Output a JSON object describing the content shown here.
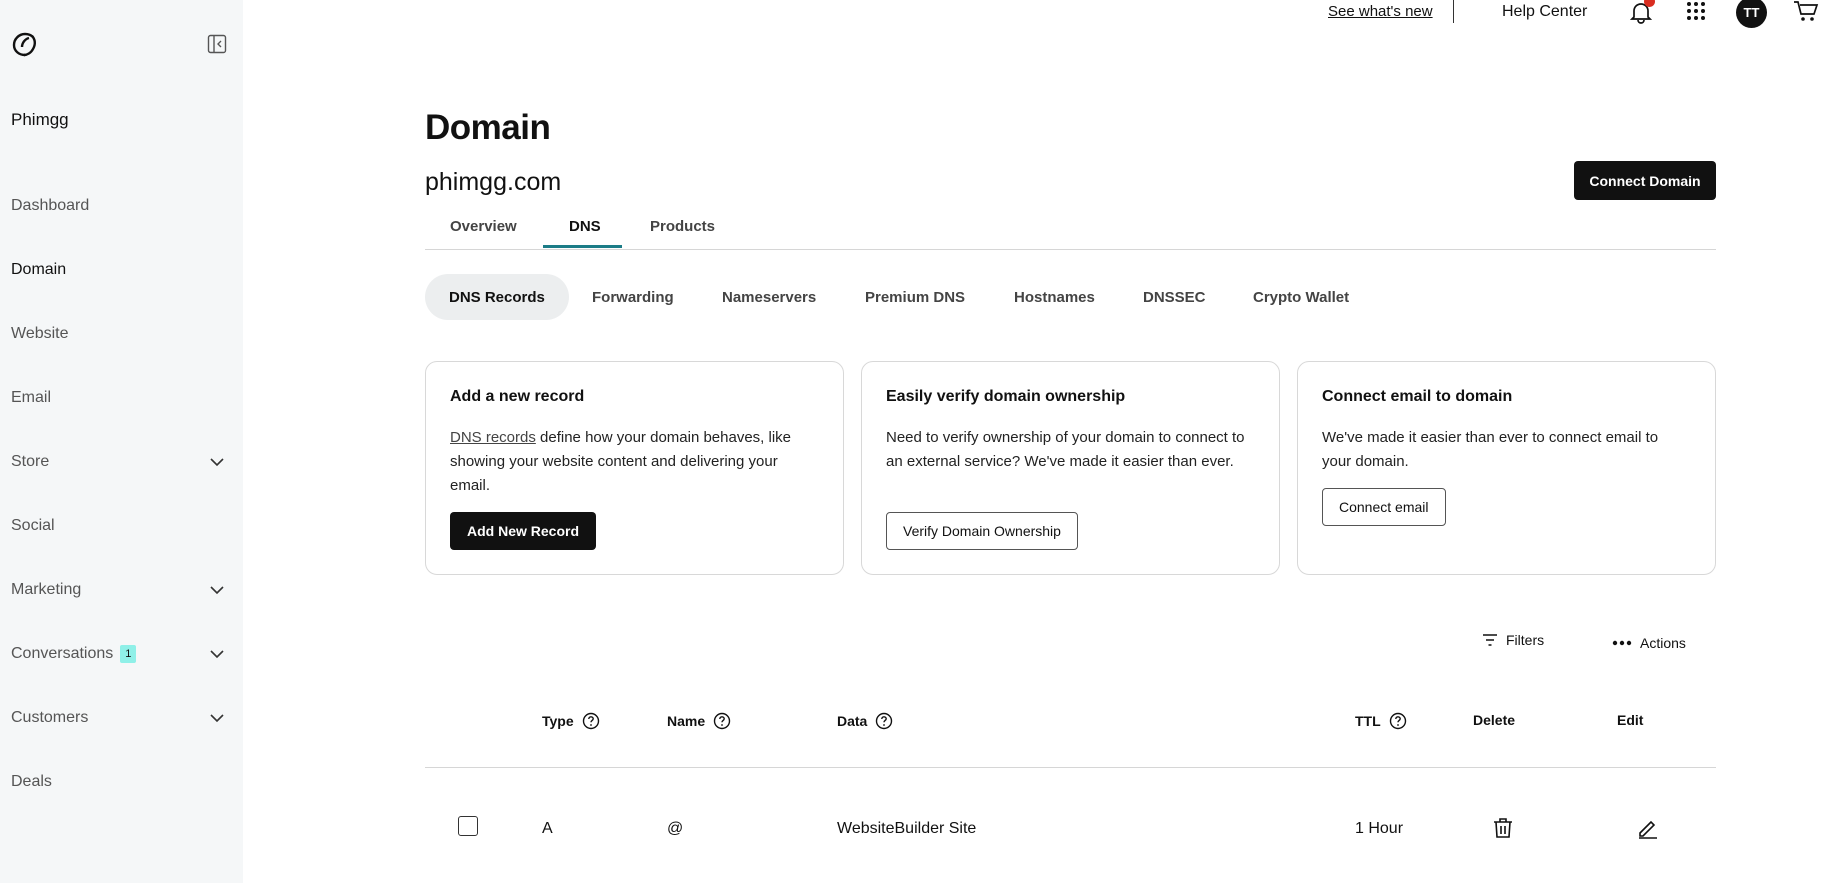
{
  "sidebar": {
    "site_name": "Phimgg",
    "items": [
      {
        "label": "Dashboard"
      },
      {
        "label": "Domain"
      },
      {
        "label": "Website"
      },
      {
        "label": "Email"
      },
      {
        "label": "Store"
      },
      {
        "label": "Social"
      },
      {
        "label": "Marketing"
      },
      {
        "label": "Conversations",
        "badge": "1"
      },
      {
        "label": "Customers"
      },
      {
        "label": "Deals"
      }
    ]
  },
  "topbar": {
    "whats_new": "See what's new",
    "help_center": "Help Center",
    "avatar_initials": "TT"
  },
  "page": {
    "title": "Domain",
    "domain": "phimgg.com",
    "connect_domain": "Connect Domain"
  },
  "tabs": [
    {
      "label": "Overview"
    },
    {
      "label": "DNS"
    },
    {
      "label": "Products"
    }
  ],
  "subtabs": [
    {
      "label": "DNS Records"
    },
    {
      "label": "Forwarding"
    },
    {
      "label": "Nameservers"
    },
    {
      "label": "Premium DNS"
    },
    {
      "label": "Hostnames"
    },
    {
      "label": "DNSSEC"
    },
    {
      "label": "Crypto Wallet"
    }
  ],
  "cards": {
    "add": {
      "title": "Add a new record",
      "link": "DNS records",
      "text": " define how your domain behaves, like showing your website content and delivering your email.",
      "button": "Add New Record"
    },
    "verify": {
      "title": "Easily verify domain ownership",
      "text": "Need to verify ownership of your domain to connect to an external service? We've made it easier than ever.",
      "button": "Verify Domain Ownership"
    },
    "email": {
      "title": "Connect email to domain",
      "text": "We've made it easier than ever to connect email to your domain.",
      "button": "Connect email"
    }
  },
  "toolbar": {
    "filters": "Filters",
    "actions": "Actions"
  },
  "table": {
    "headers": {
      "type": "Type",
      "name": "Name",
      "data": "Data",
      "ttl": "TTL",
      "delete": "Delete",
      "edit": "Edit"
    },
    "rows": [
      {
        "type": "A",
        "name": "@",
        "data": "WebsiteBuilder Site",
        "ttl": "1 Hour"
      }
    ]
  }
}
